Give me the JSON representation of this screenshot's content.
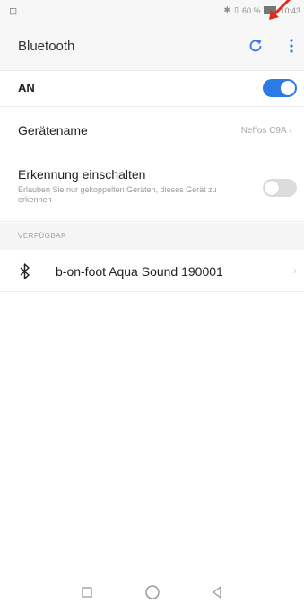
{
  "status": {
    "left_icon": "sim-icon",
    "right_text": "60 %",
    "time": "10:43"
  },
  "toolbar": {
    "title": "Bluetooth",
    "refresh_icon": "refresh-icon",
    "more_icon": "more-vert-icon"
  },
  "bluetooth_toggle": {
    "label": "AN",
    "state": "on",
    "color_on": "#2a7be4"
  },
  "device_name": {
    "label": "Gerätename",
    "value": "Neffos C9A"
  },
  "discovery": {
    "label": "Erkennung einschalten",
    "description": "Erlauben Sie nur gekoppelten Geräten, dieses Gerät zu erkennen",
    "state": "off"
  },
  "available": {
    "section_label": "VERFÜGBAR",
    "devices": [
      {
        "name": "b-on-foot Aqua Sound 190001",
        "icon": "bluetooth-icon"
      }
    ]
  },
  "nav": {
    "recent_icon": "square-icon",
    "home_icon": "circle-icon",
    "back_icon": "triangle-back-icon"
  },
  "annotation": {
    "arrow_color": "#e02a1a"
  }
}
